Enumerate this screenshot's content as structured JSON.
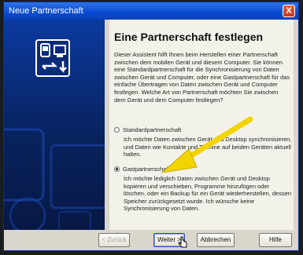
{
  "window": {
    "title": "Neue Partnerschaft",
    "close_label": "X"
  },
  "page": {
    "heading": "Eine Partnerschaft festlegen",
    "intro": "Dieser Assistent hilft Ihnen beim Herstellen einer Partnerschaft zwischen dem mobilen Gerät und diesem Computer. Sie können eine Standardpartnerschaft für die Synchronisierung von Daten zwischen Gerät und Computer, oder eine Gastpartnerschaft für das einfache Übertragen von Daten zwischen Gerät und Computer festlegen. Welche Art von Partnerschaft möchten Sie zwischen dem Gerät und dem Computer festlegen?"
  },
  "options": [
    {
      "label": "Standardpartnerschaft",
      "description": "Ich möchte Daten zwischen Gerät und Desktop synchronisieren, und Daten wie Kontakte und Termine auf beiden Geräten aktuell halten.",
      "selected": false
    },
    {
      "label": "Gastpartnerschaft",
      "description": "Ich möchte lediglich Daten zwischen Gerät und Desktop kopieren und verschieben, Programme hinzufügen oder löschen, oder ein Backup für ein Gerät wiederherstellen, dessen Speicher zurückgesetzt wurde. Ich wünsche keine Synchronisierung von Daten.",
      "selected": true
    }
  ],
  "buttons": {
    "back": "< Zurück",
    "next": "Weiter >",
    "cancel": "Abbrechen",
    "help": "Hilfe"
  },
  "colors": {
    "titlebar": "#0a4bd2",
    "banner": "#08235e",
    "annotation_arrow": "#f2d400"
  }
}
